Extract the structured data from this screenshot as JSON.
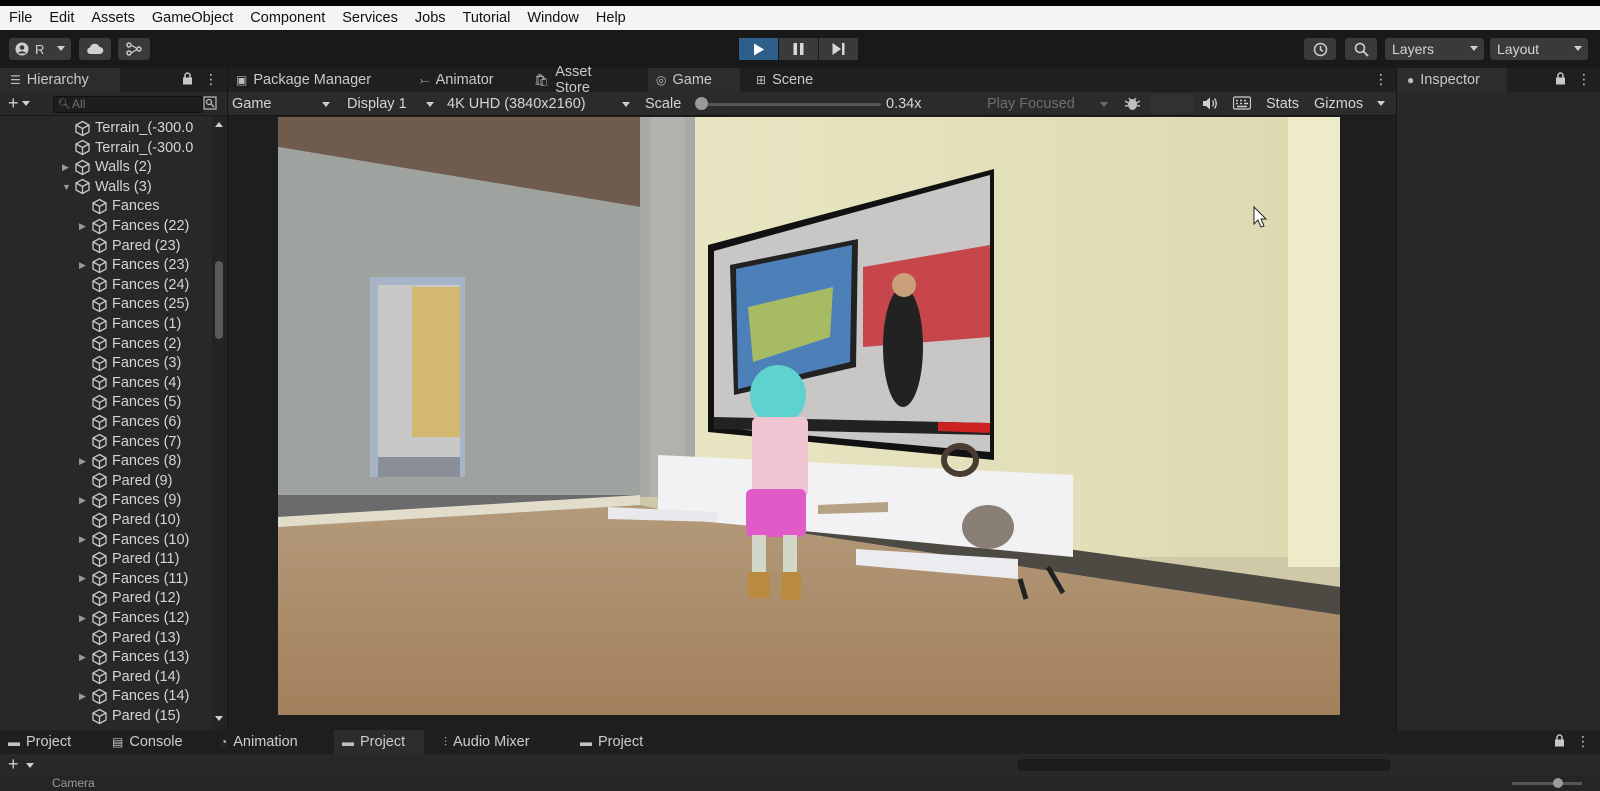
{
  "menu": [
    "File",
    "Edit",
    "Assets",
    "GameObject",
    "Component",
    "Services",
    "Jobs",
    "Tutorial",
    "Window",
    "Help"
  ],
  "toolbar": {
    "account_label": "R",
    "layers_label": "Layers",
    "layout_label": "Layout"
  },
  "hierarchy": {
    "tab_label": "Hierarchy",
    "search_placeholder": "All",
    "items": [
      {
        "label": "Terrain_(-300.0",
        "indent": 0,
        "fold": ""
      },
      {
        "label": "Terrain_(-300.0",
        "indent": 0,
        "fold": ""
      },
      {
        "label": "Walls (2)",
        "indent": 0,
        "fold": "right"
      },
      {
        "label": "Walls (3)",
        "indent": 0,
        "fold": "down"
      },
      {
        "label": "Fances",
        "indent": 1,
        "fold": ""
      },
      {
        "label": "Fances (22)",
        "indent": 1,
        "fold": "right"
      },
      {
        "label": "Pared (23)",
        "indent": 1,
        "fold": ""
      },
      {
        "label": "Fances (23)",
        "indent": 1,
        "fold": "right"
      },
      {
        "label": "Fances (24)",
        "indent": 1,
        "fold": ""
      },
      {
        "label": "Fances (25)",
        "indent": 1,
        "fold": ""
      },
      {
        "label": "Fances (1)",
        "indent": 1,
        "fold": ""
      },
      {
        "label": "Fances (2)",
        "indent": 1,
        "fold": ""
      },
      {
        "label": "Fances (3)",
        "indent": 1,
        "fold": ""
      },
      {
        "label": "Fances (4)",
        "indent": 1,
        "fold": ""
      },
      {
        "label": "Fances (5)",
        "indent": 1,
        "fold": ""
      },
      {
        "label": "Fances (6)",
        "indent": 1,
        "fold": ""
      },
      {
        "label": "Fances (7)",
        "indent": 1,
        "fold": ""
      },
      {
        "label": "Fances (8)",
        "indent": 1,
        "fold": "right"
      },
      {
        "label": "Pared (9)",
        "indent": 1,
        "fold": ""
      },
      {
        "label": "Fances (9)",
        "indent": 1,
        "fold": "right"
      },
      {
        "label": "Pared (10)",
        "indent": 1,
        "fold": ""
      },
      {
        "label": "Fances (10)",
        "indent": 1,
        "fold": "right"
      },
      {
        "label": "Pared (11)",
        "indent": 1,
        "fold": ""
      },
      {
        "label": "Fances (11)",
        "indent": 1,
        "fold": "right"
      },
      {
        "label": "Pared (12)",
        "indent": 1,
        "fold": ""
      },
      {
        "label": "Fances (12)",
        "indent": 1,
        "fold": "right"
      },
      {
        "label": "Pared (13)",
        "indent": 1,
        "fold": ""
      },
      {
        "label": "Fances (13)",
        "indent": 1,
        "fold": "right"
      },
      {
        "label": "Pared (14)",
        "indent": 1,
        "fold": ""
      },
      {
        "label": "Fances (14)",
        "indent": 1,
        "fold": "right"
      },
      {
        "label": "Pared (15)",
        "indent": 1,
        "fold": ""
      }
    ]
  },
  "center_tabs": [
    {
      "label": "Package Manager",
      "icon": "package-icon"
    },
    {
      "label": "Animator",
      "icon": "animator-icon"
    },
    {
      "label": "Asset Store",
      "icon": "store-bag-icon"
    },
    {
      "label": "Game",
      "icon": "gamepad-icon",
      "active": true
    },
    {
      "label": "Scene",
      "icon": "grid-icon"
    }
  ],
  "game_bar": {
    "view_label": "Game",
    "display_label": "Display 1",
    "resolution_label": "4K UHD (3840x2160)",
    "scale_label": "Scale",
    "scale_value": "0.34x",
    "scale_fraction": 0.0,
    "play_mode_label": "Play Focused",
    "stats_label": "Stats",
    "gizmos_label": "Gizmos"
  },
  "inspector": {
    "tab_label": "Inspector"
  },
  "bottom_tabs": [
    {
      "label": "Project",
      "icon": "folder-icon"
    },
    {
      "label": "Console",
      "icon": "console-icon"
    },
    {
      "label": "Animation",
      "icon": "animation-clock-icon"
    },
    {
      "label": "Project",
      "icon": "folder-icon",
      "active": true
    },
    {
      "label": "Audio Mixer",
      "icon": "audio-mixer-icon"
    },
    {
      "label": "Project",
      "icon": "folder-icon"
    }
  ],
  "bottom_row_label": "Camera",
  "colors": {
    "play_active": "#2e5f8a",
    "panel_bg": "#282828",
    "tab_active": "#2c2c2c"
  }
}
